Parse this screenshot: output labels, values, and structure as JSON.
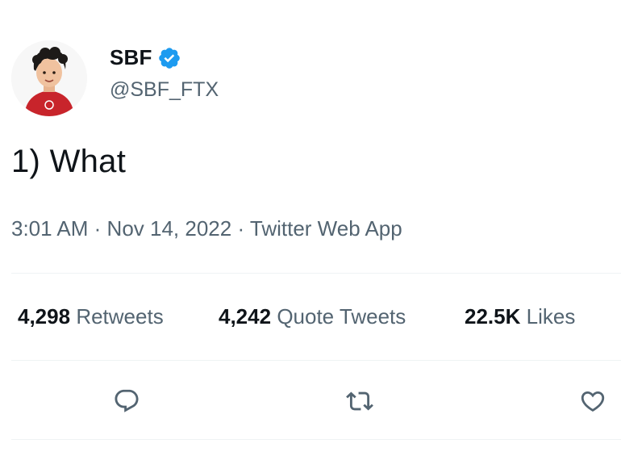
{
  "author": {
    "display_name": "SBF",
    "handle": "@SBF_FTX",
    "verified": true
  },
  "tweet": {
    "text": "1) What",
    "time": "3:01 AM",
    "date": "Nov 14, 2022",
    "source": "Twitter Web App",
    "separator": "·"
  },
  "stats": {
    "retweets": {
      "count": "4,298",
      "label": "Retweets"
    },
    "quotes": {
      "count": "4,242",
      "label": "Quote Tweets"
    },
    "likes": {
      "count": "22.5K",
      "label": "Likes"
    }
  },
  "colors": {
    "text": "#0f1419",
    "secondary": "#536471",
    "verified": "#1d9bf0",
    "divider": "#eff3f4",
    "avatar_shirt": "#c8242b"
  },
  "icons": {
    "verified": "verified-badge-icon",
    "reply": "reply-icon",
    "retweet": "retweet-icon",
    "like": "heart-icon"
  }
}
